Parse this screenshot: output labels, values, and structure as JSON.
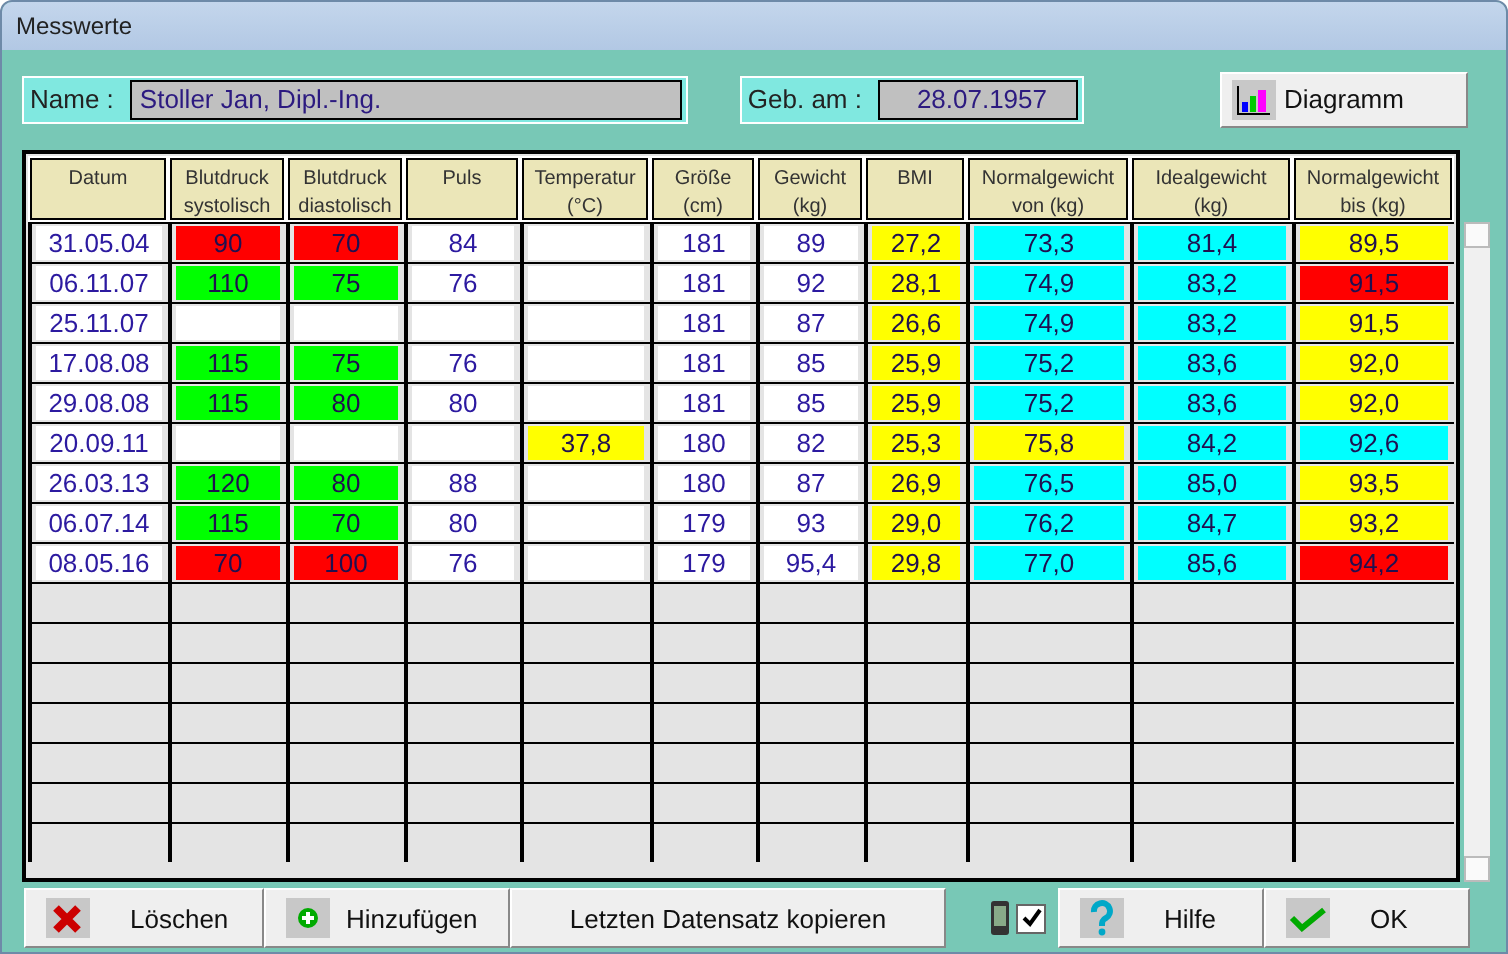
{
  "window": {
    "title": "Messwerte"
  },
  "patient": {
    "name_label": "Name :",
    "name": "Stoller Jan, Dipl.-Ing.",
    "birth_label": "Geb. am :",
    "birth_date": "28.07.1957"
  },
  "chart_button": "Diagramm",
  "table": {
    "columns": [
      "Datum",
      "Blutdruck\nsystolisch",
      "Blutdruck\ndiastolisch",
      "Puls",
      "Temperatur\n(°C)",
      "Größe\n(cm)",
      "Gewicht\n(kg)",
      "BMI",
      "Normalgewicht\nvon (kg)",
      "Idealgewicht\n(kg)",
      "Normalgewicht\nbis (kg)"
    ],
    "rows": [
      {
        "cells": [
          {
            "text": "31.05.04",
            "color": "#ffffff"
          },
          {
            "text": "90",
            "color": "#ff0000"
          },
          {
            "text": "70",
            "color": "#ff0000"
          },
          {
            "text": "84",
            "color": "#ffffff"
          },
          {
            "color": "#ffffff"
          },
          {
            "text": "181",
            "color": "#ffffff"
          },
          {
            "text": "89",
            "color": "#ffffff"
          },
          {
            "text": "27,2",
            "color": "#ffff00"
          },
          {
            "text": "73,3",
            "color": "#00ffff"
          },
          {
            "text": "81,4",
            "color": "#00ffff"
          },
          {
            "text": "89,5",
            "color": "#ffff00"
          }
        ]
      },
      {
        "cells": [
          {
            "text": "06.11.07",
            "color": "#ffffff"
          },
          {
            "text": "110",
            "color": "#00ff00"
          },
          {
            "text": "75",
            "color": "#00ff00"
          },
          {
            "text": "76",
            "color": "#ffffff"
          },
          {
            "color": "#ffffff"
          },
          {
            "text": "181",
            "color": "#ffffff"
          },
          {
            "text": "92",
            "color": "#ffffff"
          },
          {
            "text": "28,1",
            "color": "#ffff00"
          },
          {
            "text": "74,9",
            "color": "#00ffff"
          },
          {
            "text": "83,2",
            "color": "#00ffff"
          },
          {
            "text": "91,5",
            "color": "#ff0000"
          }
        ]
      },
      {
        "cells": [
          {
            "text": "25.11.07",
            "color": "#ffffff"
          },
          {
            "color": "#ffffff"
          },
          {
            "color": "#ffffff"
          },
          {
            "color": "#ffffff"
          },
          {
            "color": "#ffffff"
          },
          {
            "text": "181",
            "color": "#ffffff"
          },
          {
            "text": "87",
            "color": "#ffffff"
          },
          {
            "text": "26,6",
            "color": "#ffff00"
          },
          {
            "text": "74,9",
            "color": "#00ffff"
          },
          {
            "text": "83,2",
            "color": "#00ffff"
          },
          {
            "text": "91,5",
            "color": "#ffff00"
          }
        ]
      },
      {
        "cells": [
          {
            "text": "17.08.08",
            "color": "#ffffff"
          },
          {
            "text": "115",
            "color": "#00ff00"
          },
          {
            "text": "75",
            "color": "#00ff00"
          },
          {
            "text": "76",
            "color": "#ffffff"
          },
          {
            "color": "#ffffff"
          },
          {
            "text": "181",
            "color": "#ffffff"
          },
          {
            "text": "85",
            "color": "#ffffff"
          },
          {
            "text": "25,9",
            "color": "#ffff00"
          },
          {
            "text": "75,2",
            "color": "#00ffff"
          },
          {
            "text": "83,6",
            "color": "#00ffff"
          },
          {
            "text": "92,0",
            "color": "#ffff00"
          }
        ]
      },
      {
        "cells": [
          {
            "text": "29.08.08",
            "color": "#ffffff"
          },
          {
            "text": "115",
            "color": "#00ff00"
          },
          {
            "text": "80",
            "color": "#00ff00"
          },
          {
            "text": "80",
            "color": "#ffffff"
          },
          {
            "color": "#ffffff"
          },
          {
            "text": "181",
            "color": "#ffffff"
          },
          {
            "text": "85",
            "color": "#ffffff"
          },
          {
            "text": "25,9",
            "color": "#ffff00"
          },
          {
            "text": "75,2",
            "color": "#00ffff"
          },
          {
            "text": "83,6",
            "color": "#00ffff"
          },
          {
            "text": "92,0",
            "color": "#ffff00"
          }
        ]
      },
      {
        "cells": [
          {
            "text": "20.09.11",
            "color": "#ffffff"
          },
          {
            "color": "#ffffff"
          },
          {
            "color": "#ffffff"
          },
          {
            "color": "#ffffff"
          },
          {
            "text": "37,8",
            "color": "#ffff00"
          },
          {
            "text": "180",
            "color": "#ffffff"
          },
          {
            "text": "82",
            "color": "#ffffff"
          },
          {
            "text": "25,3",
            "color": "#ffff00"
          },
          {
            "text": "75,8",
            "color": "#ffff00"
          },
          {
            "text": "84,2",
            "color": "#00ffff"
          },
          {
            "text": "92,6",
            "color": "#00ffff"
          }
        ]
      },
      {
        "cells": [
          {
            "text": "26.03.13",
            "color": "#ffffff"
          },
          {
            "text": "120",
            "color": "#00ff00"
          },
          {
            "text": "80",
            "color": "#00ff00"
          },
          {
            "text": "88",
            "color": "#ffffff"
          },
          {
            "color": "#ffffff"
          },
          {
            "text": "180",
            "color": "#ffffff"
          },
          {
            "text": "87",
            "color": "#ffffff"
          },
          {
            "text": "26,9",
            "color": "#ffff00"
          },
          {
            "text": "76,5",
            "color": "#00ffff"
          },
          {
            "text": "85,0",
            "color": "#00ffff"
          },
          {
            "text": "93,5",
            "color": "#ffff00"
          }
        ]
      },
      {
        "cells": [
          {
            "text": "06.07.14",
            "color": "#ffffff"
          },
          {
            "text": "115",
            "color": "#00ff00"
          },
          {
            "text": "70",
            "color": "#00ff00"
          },
          {
            "text": "80",
            "color": "#ffffff"
          },
          {
            "color": "#ffffff"
          },
          {
            "text": "179",
            "color": "#ffffff"
          },
          {
            "text": "93",
            "color": "#ffffff"
          },
          {
            "text": "29,0",
            "color": "#ffff00"
          },
          {
            "text": "76,2",
            "color": "#00ffff"
          },
          {
            "text": "84,7",
            "color": "#00ffff"
          },
          {
            "text": "93,2",
            "color": "#ffff00"
          }
        ]
      },
      {
        "cells": [
          {
            "text": "08.05.16",
            "color": "#ffffff"
          },
          {
            "text": "70",
            "color": "#ff0000"
          },
          {
            "text": "100",
            "color": "#ff0000"
          },
          {
            "text": "76",
            "color": "#ffffff"
          },
          {
            "color": "#ffffff"
          },
          {
            "text": "179",
            "color": "#ffffff"
          },
          {
            "text": "95,4",
            "color": "#ffffff"
          },
          {
            "text": "29,8",
            "color": "#ffff00"
          },
          {
            "text": "77,0",
            "color": "#00ffff"
          },
          {
            "text": "85,6",
            "color": "#00ffff"
          },
          {
            "text": "94,2",
            "color": "#ff0000"
          }
        ]
      }
    ]
  },
  "buttons": [
    {
      "kind": "delete",
      "label": "Löschen"
    },
    {
      "kind": "add",
      "label": "Hinzufügen"
    },
    {
      "kind": "copy",
      "label": "Letzten Datensatz kopieren"
    },
    {
      "kind": "toggle",
      "checked": true
    },
    {
      "kind": "help",
      "label": "Hilfe"
    },
    {
      "kind": "ok",
      "label": "OK"
    }
  ]
}
